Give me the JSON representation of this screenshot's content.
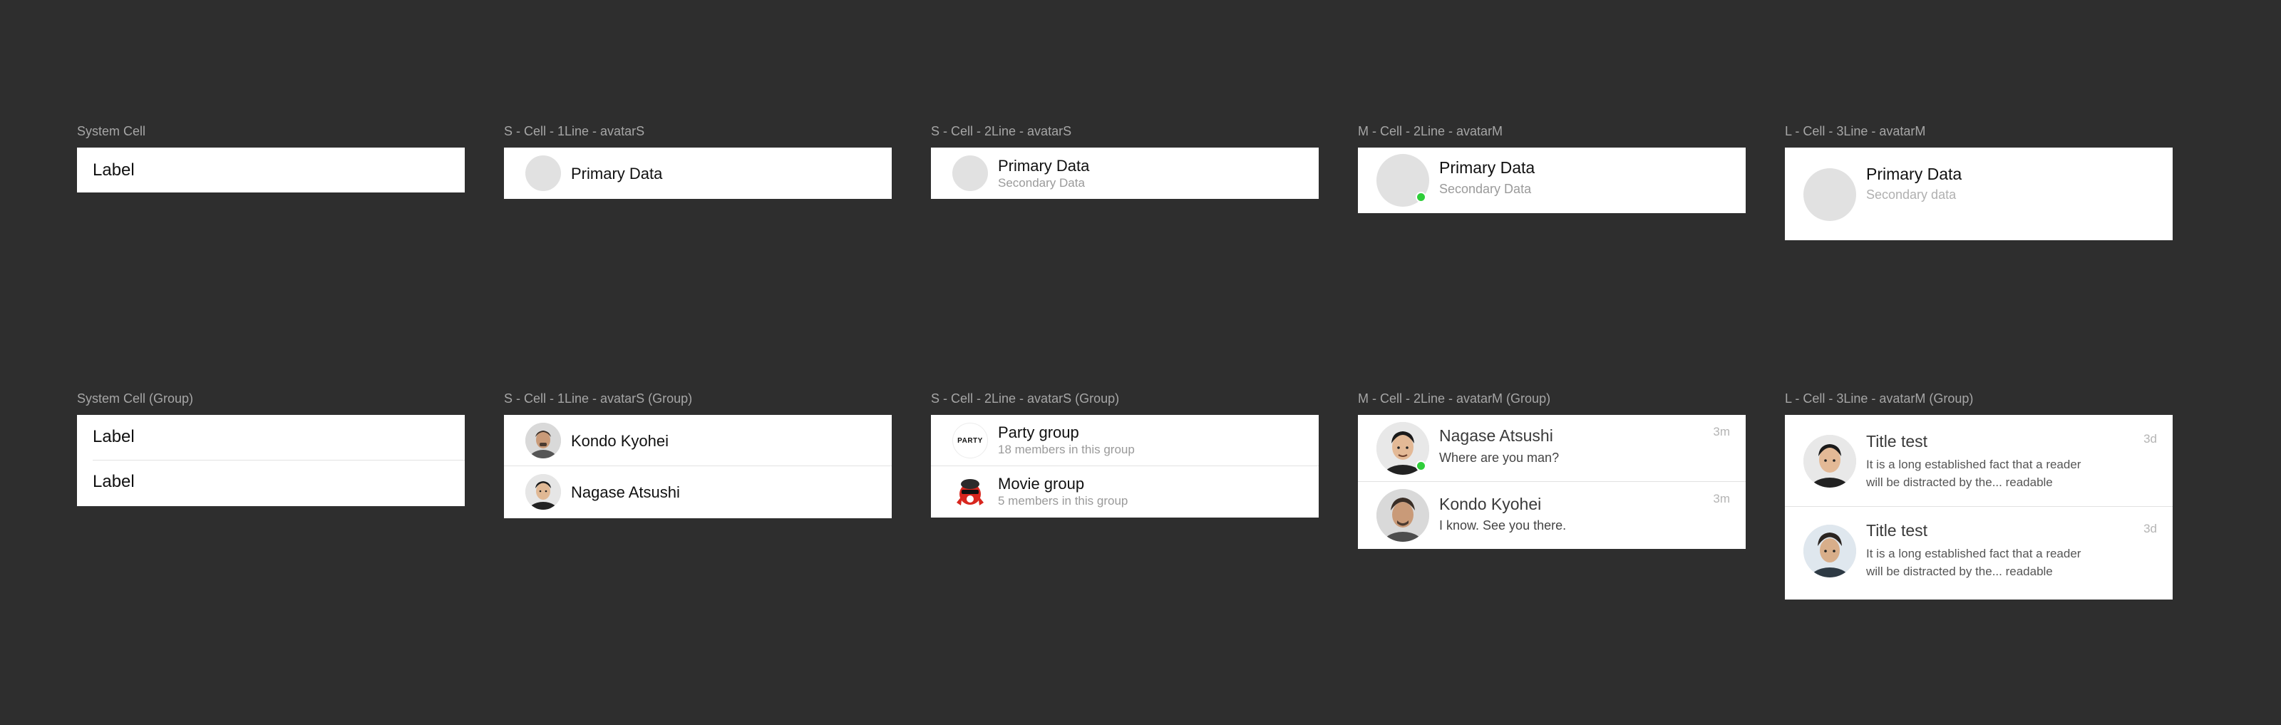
{
  "row1": {
    "system_cell": {
      "title": "System Cell",
      "label": "Label"
    },
    "s_1line": {
      "title": "S - Cell - 1Line - avatarS",
      "primary": "Primary Data"
    },
    "s_2line": {
      "title": "S - Cell - 2Line - avatarS",
      "primary": "Primary Data",
      "secondary": "Secondary Data"
    },
    "m_2line": {
      "title": "M - Cell - 2Line - avatarM",
      "primary": "Primary Data",
      "secondary": "Secondary Data"
    },
    "l_3line": {
      "title": "L - Cell - 3Line - avatarM",
      "primary": "Primary Data",
      "secondary": "Secondary data"
    }
  },
  "row2": {
    "system_group": {
      "title": "System Cell (Group)",
      "labels": [
        "Label",
        "Label"
      ]
    },
    "s_1line_group": {
      "title": "S - Cell - 1Line - avatarS (Group)",
      "items": [
        {
          "name": "Kondo Kyohei"
        },
        {
          "name": "Nagase Atsushi"
        }
      ]
    },
    "s_2line_group": {
      "title": "S - Cell - 2Line - avatarS (Group)",
      "logo_text": "PARTY",
      "items": [
        {
          "name": "Party group",
          "sub": "18 members in this group"
        },
        {
          "name": "Movie group",
          "sub": "5 members in this group"
        }
      ]
    },
    "m_2line_group": {
      "title": "M - Cell - 2Line - avatarM (Group)",
      "items": [
        {
          "name": "Nagase Atsushi",
          "message": "Where are you man?",
          "time": "3m"
        },
        {
          "name": "Kondo Kyohei",
          "message": "I know. See you there.",
          "time": "3m"
        }
      ]
    },
    "l_3line_group": {
      "title": "L - Cell - 3Line - avatarM (Group)",
      "items": [
        {
          "title": "Title test",
          "line1": "It is a long established fact that a reader",
          "line2": "will be distracted by the... readable",
          "time": "3d"
        },
        {
          "title": "Title test",
          "line1": "It is a long established fact that a reader",
          "line2": "will be distracted by the... readable",
          "time": "3d"
        }
      ]
    }
  },
  "colors": {
    "background": "#2e2e2e",
    "card": "#ffffff",
    "placeholder": "#e1e1e1",
    "online": "#2fce3a",
    "muted": "#9a9a9a"
  }
}
